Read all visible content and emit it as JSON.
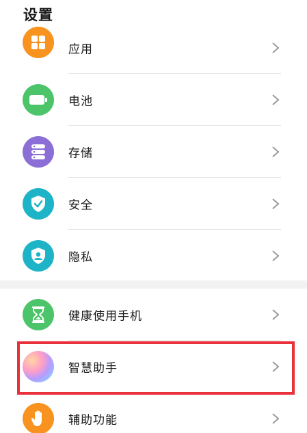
{
  "header": {
    "title": "设置"
  },
  "items_group1": [
    {
      "label": "应用",
      "icon": "apps-icon",
      "color": "#f7931e"
    },
    {
      "label": "电池",
      "icon": "battery-icon",
      "color": "#4cc46a"
    },
    {
      "label": "存储",
      "icon": "storage-icon",
      "color": "#8b6fd6"
    },
    {
      "label": "安全",
      "icon": "shield-check-icon",
      "color": "#1cb4c6"
    },
    {
      "label": "隐私",
      "icon": "privacy-shield-icon",
      "color": "#1cb4c6"
    }
  ],
  "items_group2": [
    {
      "label": "健康使用手机",
      "icon": "hourglass-icon",
      "color": "#4cc46a"
    },
    {
      "label": "智慧助手",
      "icon": "assistant-orb-icon",
      "color": "#a0c4ff"
    },
    {
      "label": "辅助功能",
      "icon": "hand-icon",
      "color": "#f7931e"
    }
  ],
  "highlight": {
    "color": "#e8313a",
    "target": "智慧助手"
  }
}
